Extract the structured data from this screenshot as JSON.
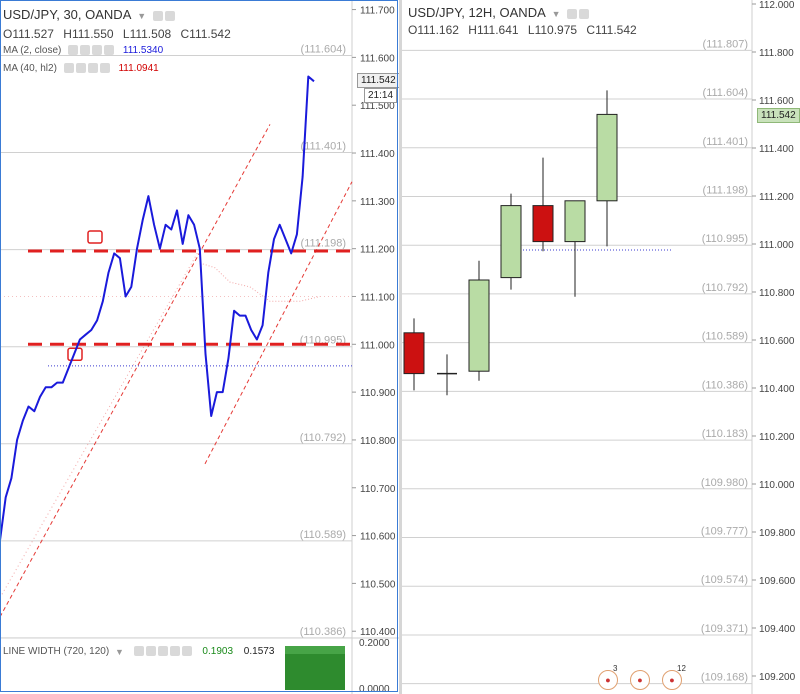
{
  "left": {
    "title": "USD/JPY, 30, OANDA",
    "ohlc": {
      "o": "O111.527",
      "h": "H111.550",
      "l": "L111.508",
      "c": "C111.542"
    },
    "indicators": [
      {
        "label": "MA (2, close)",
        "value": "111.5340",
        "color": "#1a1adb"
      },
      {
        "label": "MA (40, hl2)",
        "value": "111.0941",
        "color": "#d10000"
      }
    ],
    "price_tag": "111.542",
    "time_tag": "21:14",
    "line_width": {
      "label": "LINE WIDTH (720, 120)",
      "v1": "0.1903",
      "v2": "0.1573",
      "ticks": [
        "0.2000",
        "0.0000"
      ]
    }
  },
  "right": {
    "title": "USD/JPY, 12H, OANDA",
    "ohlc": {
      "o": "O111.162",
      "h": "H111.641",
      "l": "L110.975",
      "c": "C111.542"
    },
    "price_tag": "111.542",
    "events": [
      {
        "badge": "3"
      },
      {
        "badge": ""
      },
      {
        "badge": "12"
      }
    ]
  },
  "chart_data": [
    {
      "type": "line",
      "title": "USD/JPY, 30, OANDA",
      "ylim": [
        110.39,
        111.72
      ],
      "y_ticks": [
        "111.700",
        "111.600",
        "111.500",
        "111.400",
        "111.300",
        "111.200",
        "111.100",
        "111.000",
        "110.900",
        "110.800",
        "110.700",
        "110.600",
        "110.500",
        "110.400"
      ],
      "fib_levels": [
        "111.604",
        "111.401",
        "111.198",
        "110.995",
        "110.792",
        "110.589",
        "110.386"
      ],
      "series": [
        {
          "values": [
            110.59,
            110.68,
            110.72,
            110.8,
            110.84,
            110.87,
            110.86,
            110.89,
            110.91,
            110.91,
            110.92,
            110.92,
            110.95,
            110.98,
            111.01,
            111.02,
            111.03,
            111.05,
            111.09,
            111.15,
            111.19,
            111.18,
            111.1,
            111.12,
            111.2,
            111.26,
            111.31,
            111.25,
            111.2,
            111.25,
            111.24,
            111.28,
            111.21,
            111.27,
            111.25,
            111.2,
            110.98,
            110.85,
            110.9,
            110.9,
            110.97,
            111.07,
            111.06,
            111.06,
            111.03,
            111.01,
            111.04,
            111.15,
            111.22,
            111.25,
            111.22,
            111.19,
            111.23,
            111.35,
            111.56,
            111.55
          ]
        }
      ]
    },
    {
      "type": "candlestick",
      "title": "USD/JPY, 12H, OANDA",
      "ylim": [
        109.2,
        112.0
      ],
      "y_ticks": [
        "112.000",
        "111.800",
        "111.600",
        "111.400",
        "111.200",
        "111.000",
        "110.800",
        "110.600",
        "110.400",
        "110.200",
        "110.000",
        "109.800",
        "109.600",
        "109.400",
        "109.200"
      ],
      "fib_levels": [
        "111.807",
        "111.604",
        "111.401",
        "111.198",
        "110.995",
        "110.792",
        "110.589",
        "110.386",
        "110.183",
        "109.980",
        "109.777",
        "109.574",
        "109.371",
        "109.168"
      ],
      "candles": [
        {
          "o": 110.63,
          "h": 110.69,
          "l": 110.39,
          "c": 110.46
        },
        {
          "o": 110.46,
          "h": 110.54,
          "l": 110.37,
          "c": 110.46
        },
        {
          "o": 110.47,
          "h": 110.93,
          "l": 110.43,
          "c": 110.85
        },
        {
          "o": 110.86,
          "h": 111.21,
          "l": 110.81,
          "c": 111.16
        },
        {
          "o": 111.16,
          "h": 111.36,
          "l": 110.97,
          "c": 111.01
        },
        {
          "o": 111.01,
          "h": 111.18,
          "l": 110.78,
          "c": 111.18
        },
        {
          "o": 111.18,
          "h": 111.64,
          "l": 110.99,
          "c": 111.54
        }
      ]
    }
  ]
}
